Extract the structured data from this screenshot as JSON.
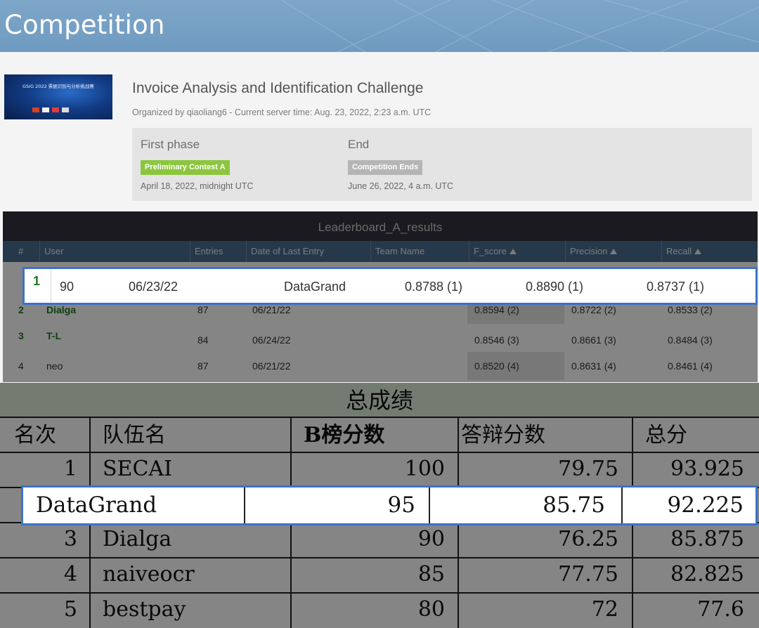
{
  "banner": {
    "title": "Competition"
  },
  "logo": {
    "text": "GSIG 2022 票据识别与分析挑战赛"
  },
  "competition": {
    "title": "Invoice Analysis and Identification Challenge",
    "subtitle": "Organized by qiaoliang6 - Current server time: Aug. 23, 2022, 2:23 a.m. UTC"
  },
  "phases": [
    {
      "name": "First phase",
      "badge": "Preliminary Contest A",
      "badge_color": "#8cc63f",
      "date": "April 18, 2022, midnight UTC"
    },
    {
      "name": "End",
      "badge": "Competition Ends",
      "badge_color": "#b5b5b5",
      "date": "June 26, 2022, 4 a.m. UTC"
    }
  ],
  "leaderboard": {
    "title": "Leaderboard_A_results",
    "columns": [
      "#",
      "User",
      "Entries",
      "Date of Last Entry",
      "Team Name",
      "F_score",
      "Precision",
      "Recall"
    ],
    "rows": [
      {
        "rank": "2",
        "user": "Dialga",
        "entries": "87",
        "date": "06/21/22",
        "team": "",
        "f": "0.8594 (2)",
        "p": "0.8722 (2)",
        "r": "0.8533 (2)"
      },
      {
        "rank": "3",
        "user": "T-L",
        "entries": "84",
        "date": "06/24/22",
        "team": "",
        "f": "0.8546 (3)",
        "p": "0.8661 (3)",
        "r": "0.8484 (3)"
      },
      {
        "rank": "4",
        "user": "neo",
        "entries": "87",
        "date": "06/21/22",
        "team": "",
        "f": "0.8520 (4)",
        "p": "0.8631 (4)",
        "r": "0.8461 (4)"
      }
    ],
    "highlight": {
      "rank": "1",
      "entries": "90",
      "date": "06/23/22",
      "team": "DataGrand",
      "f": "0.8788 (1)",
      "p": "0.8890 (1)",
      "r": "0.8737 (1)"
    }
  },
  "final": {
    "title": "总成绩",
    "columns": [
      "名次",
      "队伍名",
      "B榜分数",
      "答辩分数",
      "总分"
    ],
    "rows": [
      {
        "rank": "1",
        "team": "SECAI",
        "b": "100",
        "defense": "79.75",
        "total": "93.925"
      },
      {
        "rank": "3",
        "team": "Dialga",
        "b": "90",
        "defense": "76.25",
        "total": "85.875"
      },
      {
        "rank": "4",
        "team": "naiveocr",
        "b": "85",
        "defense": "77.75",
        "total": "82.825"
      },
      {
        "rank": "5",
        "team": "bestpay",
        "b": "80",
        "defense": "72",
        "total": "77.6"
      }
    ],
    "highlight": {
      "team": "DataGrand",
      "b": "95",
      "defense": "85.75",
      "total": "92.225"
    }
  },
  "colors": {
    "highlight_border": "#3d72c6",
    "rank_green": "#1f7a1f",
    "header_blue": "#4a6e90"
  }
}
